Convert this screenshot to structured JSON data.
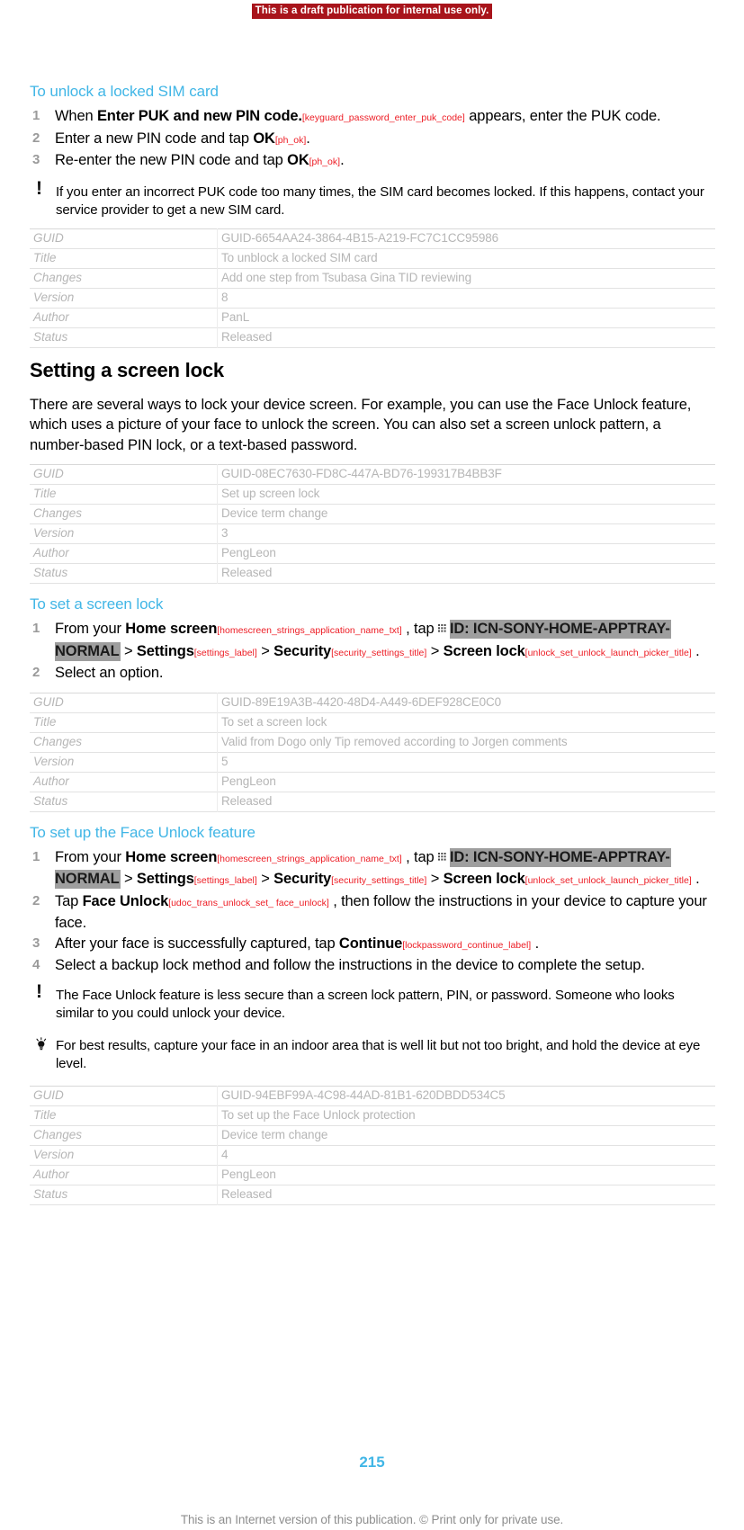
{
  "draft_banner": "This is a draft publication for internal use only.",
  "procedure_unlock_sim": {
    "heading": "To unlock a locked SIM card",
    "step1_a": "When ",
    "step1_ui": "Enter PUK and new PIN code.",
    "step1_strid": "[keyguard_password_enter_puk_code]",
    "step1_b": " appears, enter the PUK code.",
    "step2_a": "Enter a new PIN code and tap ",
    "step2_ui": "OK",
    "step2_strid": "[ph_ok]",
    "step2_b": ".",
    "step3_a": "Re-enter the new PIN code and tap ",
    "step3_ui": "OK",
    "step3_strid": "[ph_ok]",
    "step3_b": "."
  },
  "note_puk": {
    "marker": "!",
    "text": "If you enter an incorrect PUK code too many times, the SIM card becomes locked. If this happens, contact your service provider to get a new SIM card."
  },
  "meta_table_1": {
    "rows": [
      {
        "key": "GUID",
        "value": "GUID-6654AA24-3864-4B15-A219-FC7C1CC95986"
      },
      {
        "key": "Title",
        "value": "To unblock a locked SIM card"
      },
      {
        "key": "Changes",
        "value": "Add one step from Tsubasa Gina TID reviewing"
      },
      {
        "key": "Version",
        "value": "8"
      },
      {
        "key": "Author",
        "value": "PanL"
      },
      {
        "key": "Status",
        "value": "Released"
      }
    ]
  },
  "section_screen_lock": {
    "heading": "Setting a screen lock",
    "body": "There are several ways to lock your device screen. For example, you can use the Face Unlock feature, which uses a picture of your face to unlock the screen. You can also set a screen unlock pattern, a number-based PIN lock, or a text-based password."
  },
  "meta_table_2": {
    "rows": [
      {
        "key": "GUID",
        "value": "GUID-08EC7630-FD8C-447A-BD76-199317B4BB3F"
      },
      {
        "key": "Title",
        "value": "Set up screen lock"
      },
      {
        "key": "Changes",
        "value": "Device term change"
      },
      {
        "key": "Version",
        "value": "3"
      },
      {
        "key": "Author",
        "value": "PengLeon"
      },
      {
        "key": "Status",
        "value": "Released"
      }
    ]
  },
  "procedure_set_lock": {
    "heading": "To set a screen lock",
    "step1_a": "From your ",
    "step1_ui": "Home screen",
    "step1_strid": "[homescreen_strings_application_name_txt]",
    "step1_b": " , tap ",
    "step1_icon_ref": "ID: ICN-SONY-HOME-APPTRAY-NORMAL",
    "step1_sep1": " > ",
    "step1_ui2": "Settings",
    "step1_strid2": "[settings_label]",
    "step1_sep2": " > ",
    "step1_ui3": "Security",
    "step1_strid3": "[security_settings_title]",
    "step1_sep3": " > ",
    "step1_ui4": "Screen lock",
    "step1_strid4": "[unlock_set_unlock_launch_picker_title]",
    "step1_end": " .",
    "step2": "Select an option."
  },
  "meta_table_3": {
    "rows": [
      {
        "key": "GUID",
        "value": "GUID-89E19A3B-4420-48D4-A449-6DEF928CE0C0"
      },
      {
        "key": "Title",
        "value": "To set a screen lock"
      },
      {
        "key": "Changes",
        "value": "Valid from Dogo only Tip removed according to Jorgen comments"
      },
      {
        "key": "Version",
        "value": "5"
      },
      {
        "key": "Author",
        "value": "PengLeon"
      },
      {
        "key": "Status",
        "value": "Released"
      }
    ]
  },
  "procedure_face_unlock": {
    "heading": "To set up the Face Unlock feature",
    "step1_a": "From your ",
    "step1_ui": "Home screen",
    "step1_strid": "[homescreen_strings_application_name_txt]",
    "step1_b": " , tap ",
    "step1_icon_ref": "ID: ICN-SONY-HOME-APPTRAY-NORMAL",
    "step1_sep1": " > ",
    "step1_ui2": "Settings",
    "step1_strid2": "[settings_label]",
    "step1_sep2": " > ",
    "step1_ui3": "Security",
    "step1_strid3": "[security_settings_title]",
    "step1_sep3": " > ",
    "step1_ui4": "Screen lock",
    "step1_strid4": "[unlock_set_unlock_launch_picker_title]",
    "step1_end": " .",
    "step2_a": "Tap ",
    "step2_ui": "Face Unlock",
    "step2_strid": "[udoc_trans_unlock_set_ face_unlock]",
    "step2_b": " , then follow the instructions in your device to capture your face.",
    "step3_a": "After your face is successfully captured, tap ",
    "step3_ui": "Continue",
    "step3_strid": "[lockpassword_continue_label]",
    "step3_b": " .",
    "step4": "Select a backup lock method and follow the instructions in the device to complete the setup."
  },
  "note_face_unlock": {
    "marker": "!",
    "text": "The Face Unlock feature is less secure than a screen lock pattern, PIN, or password. Someone who looks similar to you could unlock your device."
  },
  "tip_face_unlock": {
    "text": "For best results, capture your face in an indoor area that is well lit but not too bright, and hold the device at eye level."
  },
  "meta_table_4": {
    "rows": [
      {
        "key": "GUID",
        "value": "GUID-94EBF99A-4C98-44AD-81B1-620DBDD534C5"
      },
      {
        "key": "Title",
        "value": "To set up the Face Unlock protection"
      },
      {
        "key": "Changes",
        "value": "Device term change"
      },
      {
        "key": "Version",
        "value": "4"
      },
      {
        "key": "Author",
        "value": "PengLeon"
      },
      {
        "key": "Status",
        "value": "Released"
      }
    ]
  },
  "footer": {
    "page_number": "215",
    "note": "This is an Internet version of this publication. © Print only for private use."
  },
  "colors": {
    "heading_blue": "#41B6E6",
    "draft_red": "#A8141B",
    "string_id_red": "#ED1C24",
    "meta_gray": "#B6B6B6",
    "icon_ref_gray": "#9E9E9E"
  }
}
